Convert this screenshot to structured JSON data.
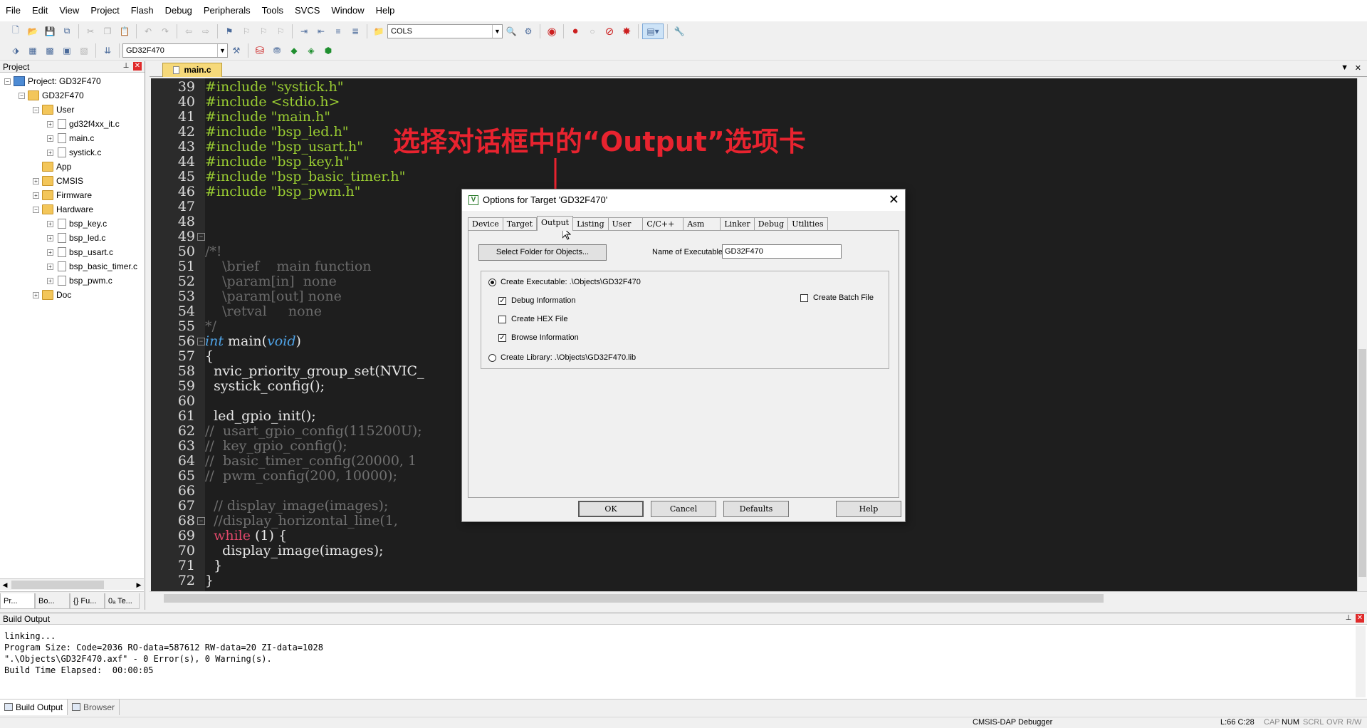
{
  "menu": [
    "File",
    "Edit",
    "View",
    "Project",
    "Flash",
    "Debug",
    "Peripherals",
    "Tools",
    "SVCS",
    "Window",
    "Help"
  ],
  "toolbar": {
    "find_combo": "COLS",
    "target_combo": "GD32F470"
  },
  "project_panel": {
    "title": "Project",
    "tree": [
      {
        "label": "Project: GD32F470",
        "type": "project"
      },
      {
        "label": "GD32F470",
        "type": "folder"
      },
      {
        "label": "User",
        "type": "folder"
      },
      {
        "label": "gd32f4xx_it.c",
        "type": "file"
      },
      {
        "label": "main.c",
        "type": "file"
      },
      {
        "label": "systick.c",
        "type": "file"
      },
      {
        "label": "App",
        "type": "folder"
      },
      {
        "label": "CMSIS",
        "type": "folder"
      },
      {
        "label": "Firmware",
        "type": "folder"
      },
      {
        "label": "Hardware",
        "type": "folder"
      },
      {
        "label": "bsp_key.c",
        "type": "file"
      },
      {
        "label": "bsp_led.c",
        "type": "file"
      },
      {
        "label": "bsp_usart.c",
        "type": "file"
      },
      {
        "label": "bsp_basic_timer.c",
        "type": "file"
      },
      {
        "label": "bsp_pwm.c",
        "type": "file"
      },
      {
        "label": "Doc",
        "type": "folder"
      }
    ],
    "tabs": [
      "Pr...",
      "Bo...",
      "{} Fu...",
      "0ₐ Te..."
    ]
  },
  "editor": {
    "tab_label": "main.c",
    "line_numbers": [
      "39",
      "40",
      "41",
      "42",
      "43",
      "44",
      "45",
      "46",
      "47",
      "48",
      "49",
      "50",
      "51",
      "52",
      "53",
      "54",
      "55",
      "56",
      "57",
      "58",
      "59",
      "60",
      "61",
      "62",
      "63",
      "64",
      "65",
      "66",
      "67",
      "68",
      "69",
      "70",
      "71",
      "72"
    ],
    "lines": {
      "l39": "#include \"systick.h\"",
      "l40": "#include <stdio.h>",
      "l41": "#include \"main.h\"",
      "l42": "#include \"bsp_led.h\"",
      "l43": "#include \"bsp_usart.h\"",
      "l44": "#include \"bsp_key.h\"",
      "l45": "#include \"bsp_basic_timer.h\"",
      "l46": "#include \"bsp_pwm.h\"",
      "l49": "/*!",
      "l50": "    \\brief    main function",
      "l51": "    \\param[in]  none",
      "l52": "    \\param[out] none",
      "l53": "    \\retval     none",
      "l54": "*/",
      "l55_kw": "int",
      "l55_fn": " main(",
      "l55_arg": "void",
      "l55_end": ")",
      "l56": "{",
      "l57": "  nvic_priority_group_set(NVIC_",
      "l58": "  systick_config();",
      "l60": "  led_gpio_init();",
      "l61": "//  usart_gpio_config(115200U);",
      "l62": "//  key_gpio_config();",
      "l63": "//  basic_timer_config(20000, 1",
      "l64": "//  pwm_config(200, 10000);",
      "l66": "  // display_image(images);",
      "l67": "  //display_horizontal_line(1,",
      "l68_kw": "  while",
      "l68_rest": " (1) {",
      "l69": "    display_image(images);",
      "l70": "  }",
      "l71": "}"
    }
  },
  "annotation": {
    "text": "选择对话框中的“Output”选项卡",
    "color": "#e8232f"
  },
  "dialog": {
    "title": "Options for Target 'GD32F470'",
    "tabs": [
      "Device",
      "Target",
      "Output",
      "Listing",
      "User",
      "C/C++",
      "Asm",
      "Linker",
      "Debug",
      "Utilities"
    ],
    "active_tab": "Output",
    "select_folder_button": "Select Folder for Objects...",
    "name_of_executable_label": "Name of Executable:",
    "name_of_executable_value": "GD32F470",
    "create_executable": "Create Executable:  .\\Objects\\GD32F470",
    "debug_information": "Debug Information",
    "create_hex_file": "Create HEX File",
    "browse_information": "Browse Information",
    "create_library": "Create Library:  .\\Objects\\GD32F470.lib",
    "create_batch_file": "Create Batch File",
    "buttons": {
      "ok": "OK",
      "cancel": "Cancel",
      "defaults": "Defaults",
      "help": "Help"
    }
  },
  "build_output": {
    "title": "Build Output",
    "lines": [
      "linking...",
      "Program Size: Code=2036 RO-data=587612 RW-data=20 ZI-data=1028",
      "\".\\Objects\\GD32F470.axf\" - 0 Error(s), 0 Warning(s).",
      "Build Time Elapsed:  00:00:05"
    ],
    "tabs": [
      "Build Output",
      "Browser"
    ]
  },
  "status_bar": {
    "debugger": "CMSIS-DAP Debugger",
    "position": "L:66 C:28",
    "indicators": [
      "CAP",
      "NUM",
      "SCRL",
      "OVR",
      "R/W"
    ]
  }
}
